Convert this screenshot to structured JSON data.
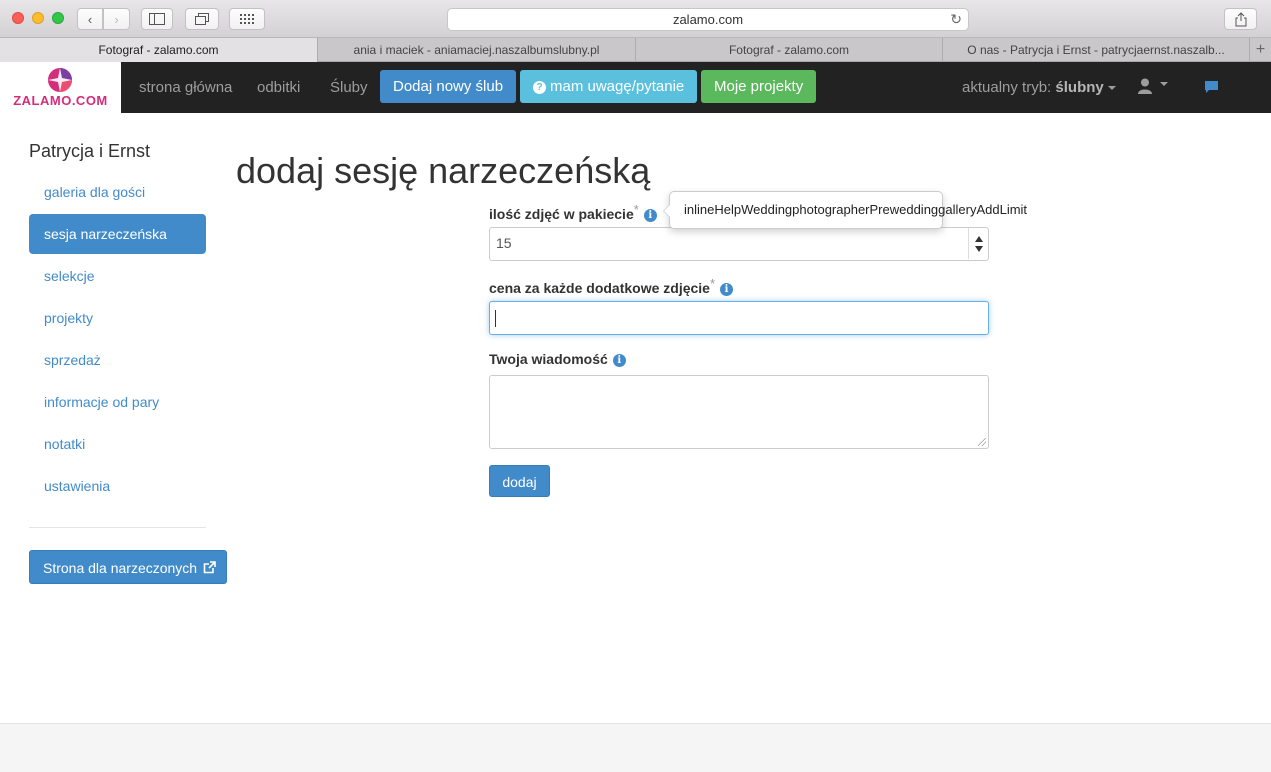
{
  "browser": {
    "url": "zalamo.com",
    "tabs": [
      {
        "label": "Fotograf - zalamo.com",
        "active": true
      },
      {
        "label": "ania i maciek - aniamaciej.naszalbumslubny.pl",
        "active": false
      },
      {
        "label": "Fotograf - zalamo.com",
        "active": false
      },
      {
        "label": "O nas - Patrycja i Ernst - patrycjaernst.naszalb...",
        "active": false
      }
    ]
  },
  "navbar": {
    "logo_text": "ZALAMO.COM",
    "links": [
      "strona główna",
      "odbitki",
      "Śluby"
    ],
    "add_wedding": "Dodaj nowy ślub",
    "feedback": "mam uwagę/pytanie",
    "projects": "Moje projekty",
    "mode_label": "aktualny tryb:",
    "mode_value": "ślubny"
  },
  "sidebar": {
    "title": "Patrycja i Ernst",
    "items": [
      {
        "label": "galeria dla gości",
        "active": false
      },
      {
        "label": "sesja narzeczeńska",
        "active": true
      },
      {
        "label": "selekcje",
        "active": false
      },
      {
        "label": "projekty",
        "active": false
      },
      {
        "label": "sprzedaż",
        "active": false
      },
      {
        "label": "informacje od pary",
        "active": false
      },
      {
        "label": "notatki",
        "active": false
      },
      {
        "label": "ustawienia",
        "active": false
      }
    ],
    "couple_page_button": "Strona dla narzeczonych"
  },
  "main": {
    "title": "dodaj sesję narzeczeńską",
    "fields": {
      "photo_count_label": "ilość zdjęć w pakiecie",
      "photo_count_value": "15",
      "extra_price_label": "cena za każde dodatkowe zdjęcie",
      "extra_price_value": "",
      "message_label": "Twoja wiadomość",
      "message_value": ""
    },
    "required_mark": "*",
    "submit": "dodaj",
    "tooltip": "inlineHelpWeddingphotographerPreweddinggalleryAddLimit"
  },
  "colors": {
    "primary": "#428bca",
    "info": "#5bc0de",
    "success": "#5cb85c",
    "navbar": "#222222",
    "logo": "#d32d7b"
  }
}
